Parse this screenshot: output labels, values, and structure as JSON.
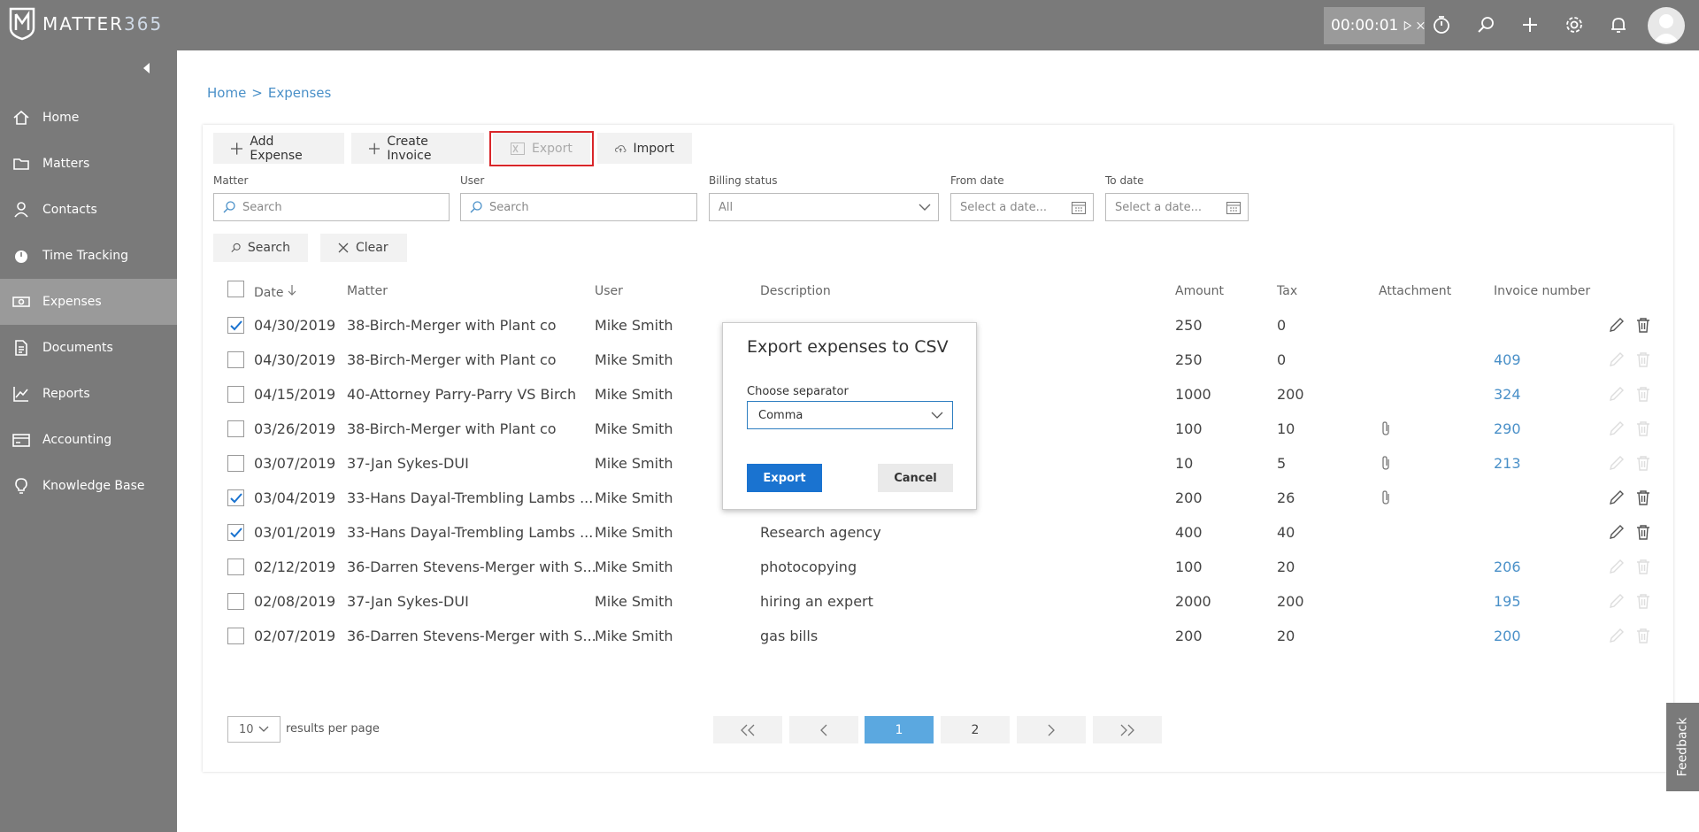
{
  "app": {
    "logo_text_main": "MATTER",
    "logo_text_accent": "365",
    "timer": "00:00:01"
  },
  "icons": {
    "logo": "shield-m-icon",
    "play": "play-icon",
    "close": "close-icon",
    "stopwatch": "stopwatch-icon",
    "search": "search-icon",
    "add": "plus-icon",
    "settings": "gear-icon",
    "notifications": "bell-icon",
    "avatar": "user-avatar-icon"
  },
  "sidebar": {
    "items": [
      {
        "label": "Home",
        "icon": "home-icon",
        "active": false
      },
      {
        "label": "Matters",
        "icon": "folder-icon",
        "active": false
      },
      {
        "label": "Contacts",
        "icon": "person-icon",
        "active": false
      },
      {
        "label": "Time Tracking",
        "icon": "stopwatch-icon",
        "active": false
      },
      {
        "label": "Expenses",
        "icon": "money-icon",
        "active": true
      },
      {
        "label": "Documents",
        "icon": "documents-icon",
        "active": false
      },
      {
        "label": "Reports",
        "icon": "chart-icon",
        "active": false
      },
      {
        "label": "Accounting",
        "icon": "accounting-icon",
        "active": false
      },
      {
        "label": "Knowledge Base",
        "icon": "lightbulb-icon",
        "active": false
      }
    ]
  },
  "breadcrumb": {
    "home": "Home",
    "separator": ">",
    "current": "Expenses"
  },
  "toolbar": {
    "add_expense": "Add Expense",
    "create_invoice": "Create Invoice",
    "export": "Export",
    "import": "Import"
  },
  "filters": {
    "matter_label": "Matter",
    "matter_placeholder": "Search",
    "user_label": "User",
    "user_placeholder": "Search",
    "billing_label": "Billing status",
    "billing_value": "All",
    "from_label": "From date",
    "from_placeholder": "Select a date...",
    "to_label": "To date",
    "to_placeholder": "Select a date...",
    "search_button": "Search",
    "clear_button": "Clear"
  },
  "table": {
    "headers": {
      "date": "Date",
      "matter": "Matter",
      "user": "User",
      "description": "Description",
      "amount": "Amount",
      "tax": "Tax",
      "attachment": "Attachment",
      "invoice": "Invoice number"
    },
    "rows": [
      {
        "checked": true,
        "date": "04/30/2019",
        "matter": "38-Birch-Merger with Plant co",
        "user": "Mike Smith",
        "description": "",
        "amount": "250",
        "tax": "0",
        "attachment": false,
        "invoice": "",
        "editable": true
      },
      {
        "checked": false,
        "date": "04/30/2019",
        "matter": "38-Birch-Merger with Plant co",
        "user": "Mike Smith",
        "description": "",
        "amount": "250",
        "tax": "0",
        "attachment": false,
        "invoice": "409",
        "editable": false
      },
      {
        "checked": false,
        "date": "04/15/2019",
        "matter": "40-Attorney Parry-Parry VS Birch",
        "user": "Mike Smith",
        "description": "",
        "amount": "1000",
        "tax": "200",
        "attachment": false,
        "invoice": "324",
        "editable": false
      },
      {
        "checked": false,
        "date": "03/26/2019",
        "matter": "38-Birch-Merger with Plant co",
        "user": "Mike Smith",
        "description": "",
        "amount": "100",
        "tax": "10",
        "attachment": true,
        "invoice": "290",
        "editable": false
      },
      {
        "checked": false,
        "date": "03/07/2019",
        "matter": "37-Jan Sykes-DUI",
        "user": "Mike Smith",
        "description": "",
        "amount": "10",
        "tax": "5",
        "attachment": true,
        "invoice": "213",
        "editable": false
      },
      {
        "checked": true,
        "date": "03/04/2019",
        "matter": "33-Hans Dayal-Trembling Lambs ...",
        "user": "Mike Smith",
        "description": "",
        "amount": "200",
        "tax": "26",
        "attachment": true,
        "invoice": "",
        "editable": true
      },
      {
        "checked": true,
        "date": "03/01/2019",
        "matter": "33-Hans Dayal-Trembling Lambs ...",
        "user": "Mike Smith",
        "description": "Research agency",
        "amount": "400",
        "tax": "40",
        "attachment": false,
        "invoice": "",
        "editable": true
      },
      {
        "checked": false,
        "date": "02/12/2019",
        "matter": "36-Darren Stevens-Merger with S...",
        "user": "Mike Smith",
        "description": "photocopying",
        "amount": "100",
        "tax": "20",
        "attachment": false,
        "invoice": "206",
        "editable": false
      },
      {
        "checked": false,
        "date": "02/08/2019",
        "matter": "37-Jan Sykes-DUI",
        "user": "Mike Smith",
        "description": "hiring an expert",
        "amount": "2000",
        "tax": "200",
        "attachment": false,
        "invoice": "195",
        "editable": false
      },
      {
        "checked": false,
        "date": "02/07/2019",
        "matter": "36-Darren Stevens-Merger with S...",
        "user": "Mike Smith",
        "description": "gas bills",
        "amount": "200",
        "tax": "20",
        "attachment": false,
        "invoice": "200",
        "editable": false
      }
    ]
  },
  "pagination": {
    "per_page": "10",
    "per_page_label": "results per page",
    "pages": [
      "1",
      "2"
    ],
    "current": "1"
  },
  "feedback": "Feedback",
  "modal": {
    "title": "Export expenses to CSV",
    "separator_label": "Choose separator",
    "separator_value": "Comma",
    "export_button": "Export",
    "cancel_button": "Cancel"
  },
  "colors": {
    "chrome": "#7a7a7a",
    "accent": "#4a90c8",
    "primary_button": "#1a73d0",
    "highlight": "#d9262a"
  }
}
